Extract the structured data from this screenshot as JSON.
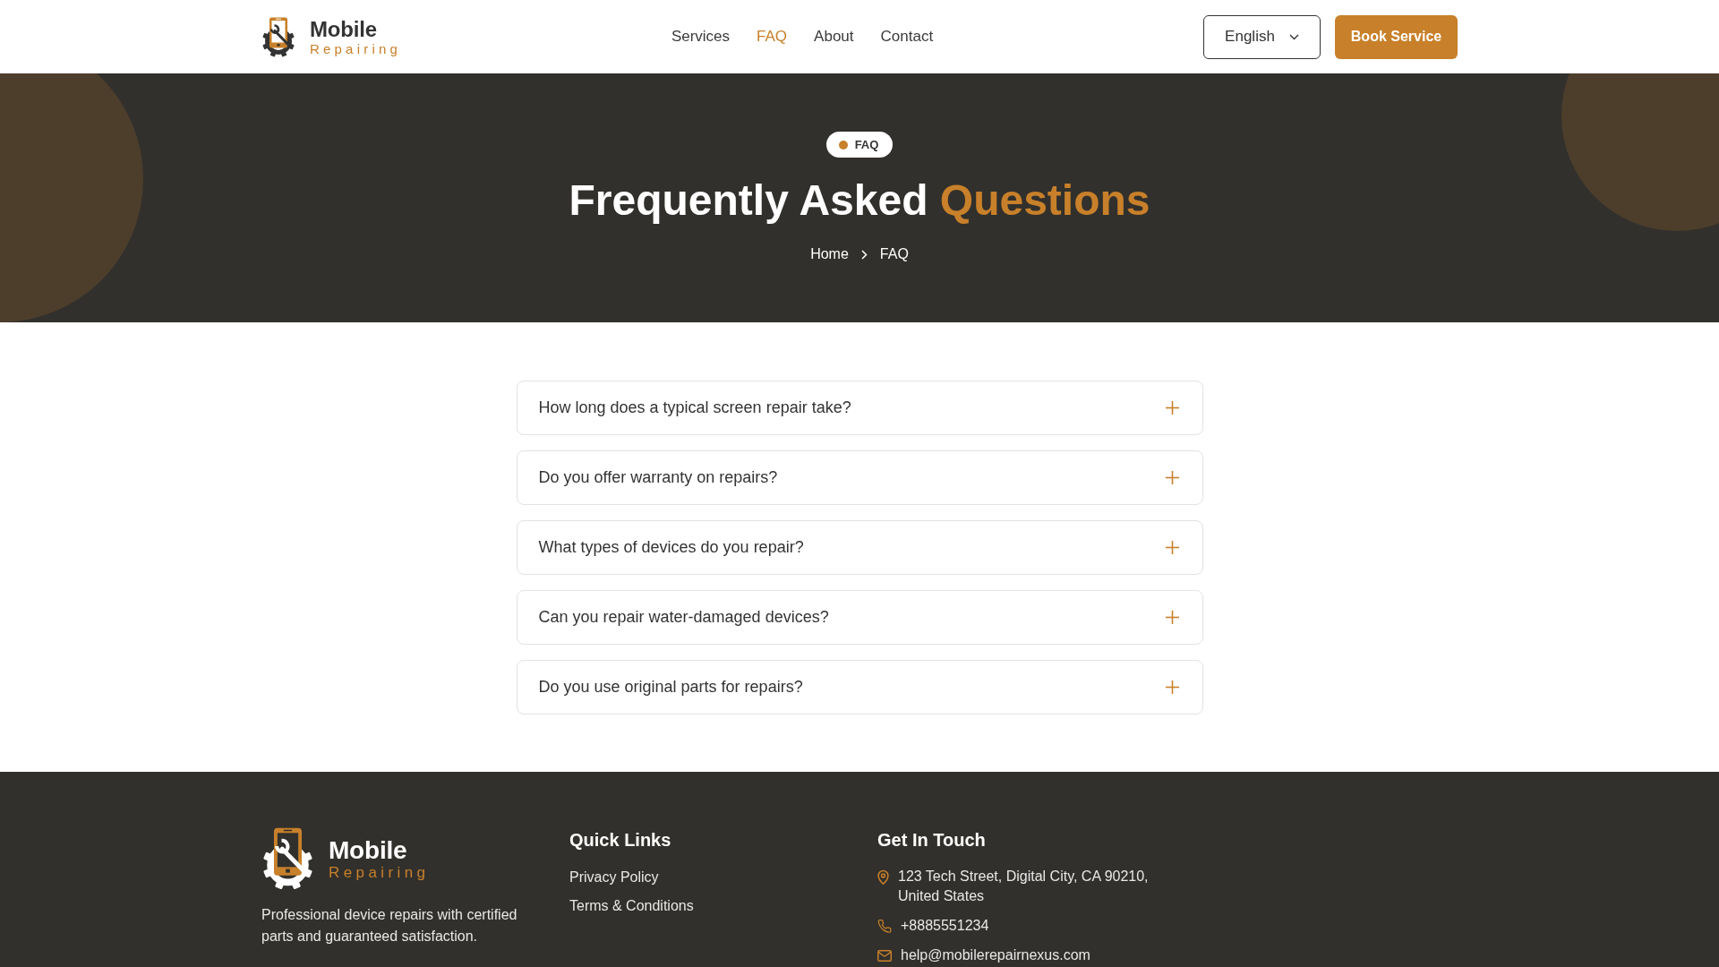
{
  "header": {
    "logo": {
      "name": "Mobile",
      "tagline": "Repairing"
    },
    "nav": [
      {
        "label": "Services",
        "selected": false
      },
      {
        "label": "FAQ",
        "selected": true
      },
      {
        "label": "About",
        "selected": false
      },
      {
        "label": "Contact",
        "selected": false
      }
    ],
    "language": "English",
    "cta": "Book Service"
  },
  "hero": {
    "badge": "FAQ",
    "title": [
      {
        "text": "Frequently Asked",
        "highlight": false
      },
      {
        "text": "Questions",
        "highlight": true
      }
    ],
    "breadcrumb": [
      "Home",
      "FAQ"
    ]
  },
  "faq": [
    {
      "question": "How long does a typical screen repair take?",
      "expanded": false
    },
    {
      "question": "Do you offer warranty on repairs?",
      "expanded": false
    },
    {
      "question": "What types of devices do you repair?",
      "expanded": false
    },
    {
      "question": "Can you repair water-damaged devices?",
      "expanded": false
    },
    {
      "question": "Do you use original parts for repairs?",
      "expanded": false
    }
  ],
  "footer": {
    "logo": {
      "name": "Mobile",
      "tagline": "Repairing"
    },
    "description": "Professional device repairs with certified parts and guaranteed satisfaction.",
    "quick_links": {
      "title": "Quick Links",
      "links": [
        "Privacy Policy",
        "Terms & Conditions"
      ]
    },
    "contact": {
      "title": "Get In Touch",
      "items": [
        {
          "kind": "address",
          "text": "123 Tech Street, Digital City, CA 90210, United States"
        },
        {
          "kind": "phone",
          "text": "+8885551234"
        },
        {
          "kind": "email",
          "text": "help@mobilerepairnexus.com"
        }
      ]
    }
  }
}
